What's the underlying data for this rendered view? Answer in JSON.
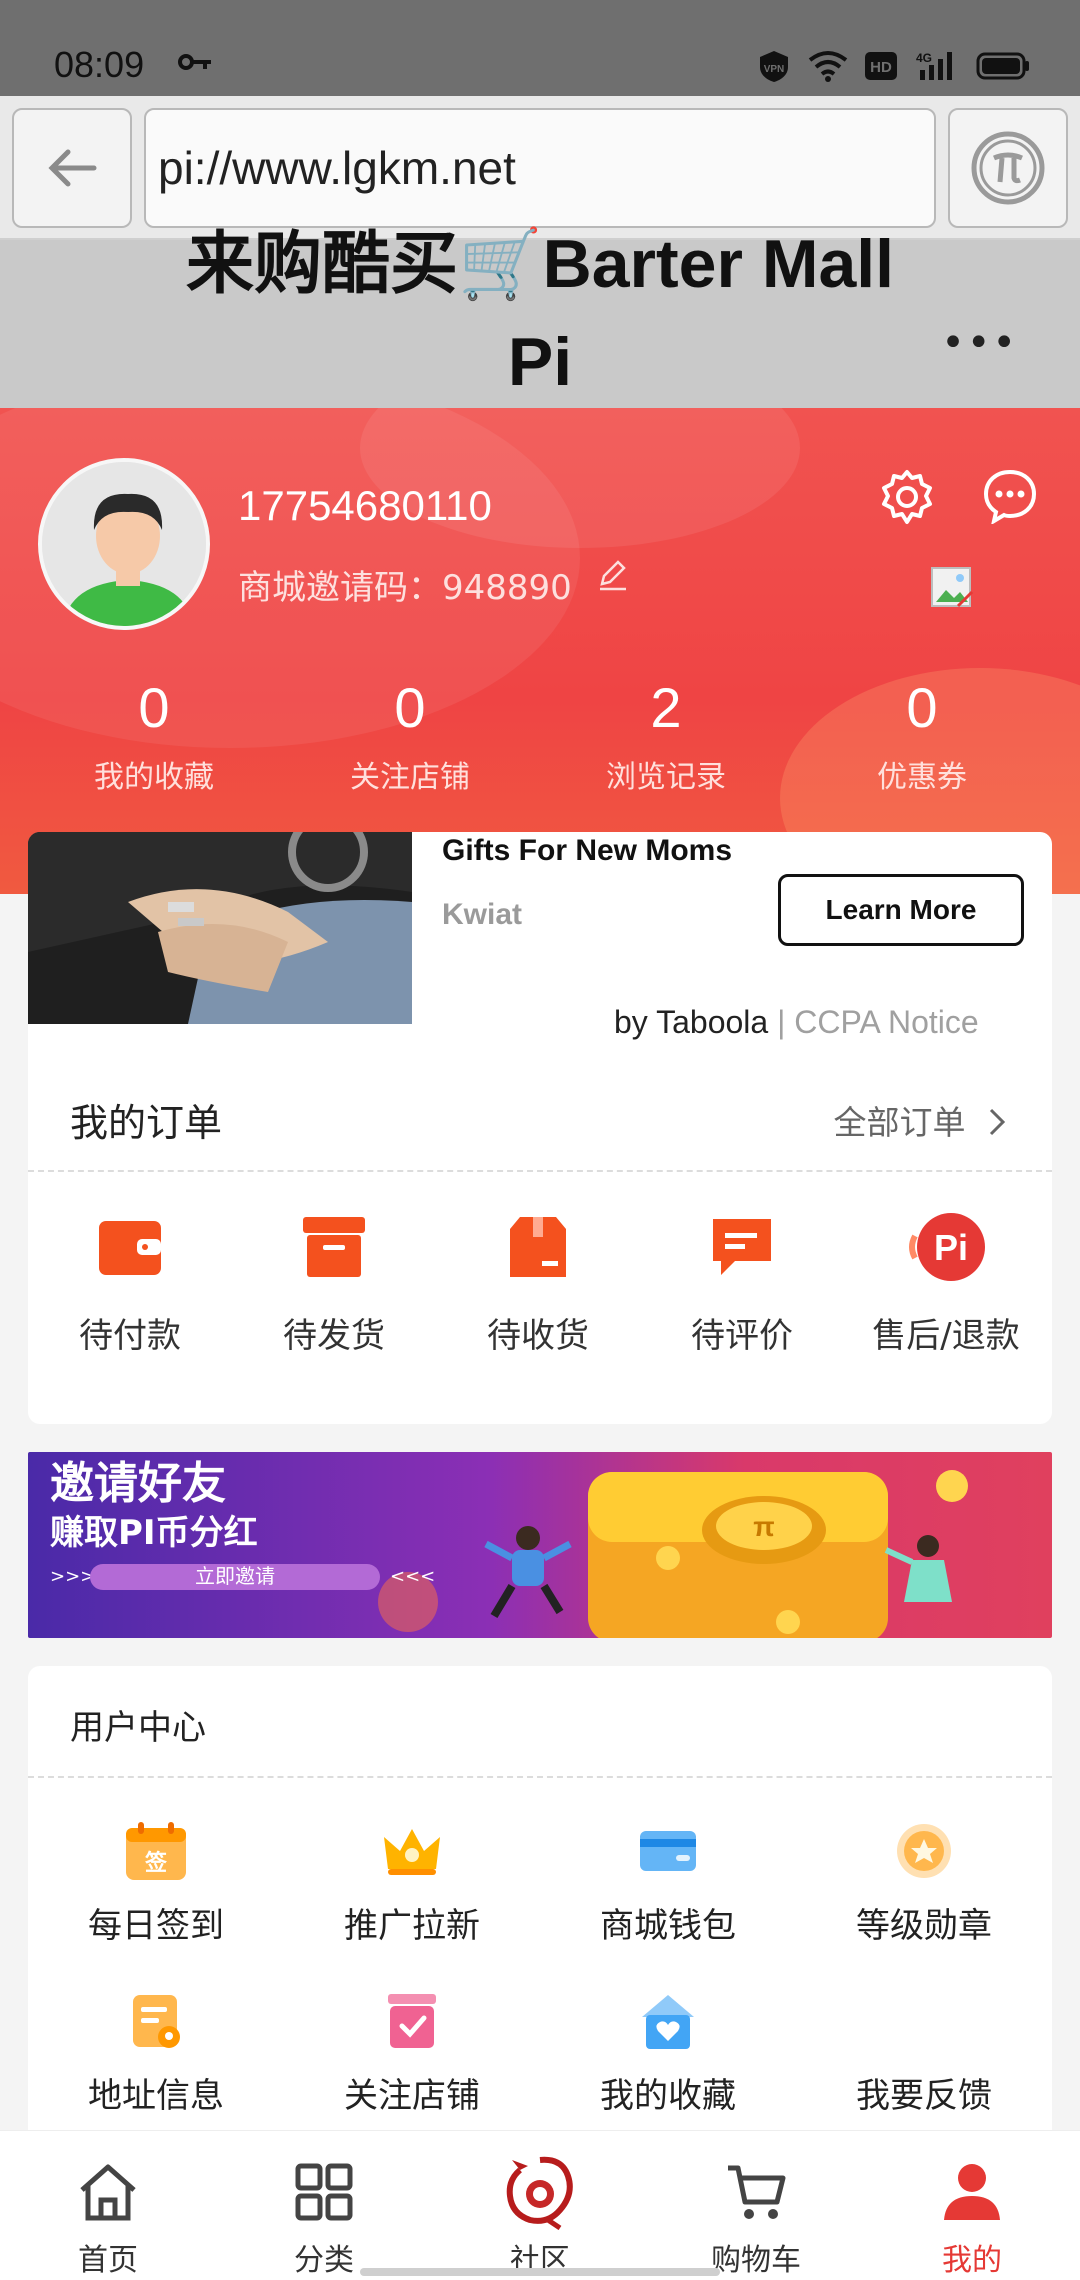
{
  "status_bar": {
    "time": "08:09",
    "icons": [
      "key-icon",
      "vpn-icon",
      "wifi-icon",
      "hd-icon",
      "4g-signal-icon",
      "battery-icon"
    ],
    "vpn_label": "VPN",
    "hd_label": "HD",
    "network_label": "4G"
  },
  "browser": {
    "url": "pi://www.lgkm.net",
    "back_icon": "arrow-left-icon",
    "pi_icon": "pi-icon"
  },
  "site": {
    "title_line1": "来购酷买🛒Barter Mall",
    "title_line2": "Pi",
    "more": "•••"
  },
  "profile": {
    "phone": "17754680110",
    "invite_code": "商城邀请码：948890",
    "stats": [
      {
        "value": "0",
        "label": "我的收藏"
      },
      {
        "value": "0",
        "label": "关注店铺"
      },
      {
        "value": "2",
        "label": "浏览记录"
      },
      {
        "value": "0",
        "label": "优惠券"
      }
    ]
  },
  "ad": {
    "title": "Gifts For New Moms",
    "source": "Kwiat",
    "button": "Learn More",
    "by": "by Taboola",
    "separator": " | ",
    "notice": "CCPA Notice"
  },
  "orders": {
    "title": "我的订单",
    "all_label": "全部订单",
    "items": [
      {
        "label": "待付款",
        "icon": "wallet-icon"
      },
      {
        "label": "待发货",
        "icon": "box-icon"
      },
      {
        "label": "待收货",
        "icon": "package-icon"
      },
      {
        "label": "待评价",
        "icon": "comment-icon"
      },
      {
        "label": "售后/退款",
        "icon": "pi-refund-icon"
      }
    ]
  },
  "banner": {
    "line1": "邀请好友",
    "line2": "赚取PI币分红",
    "cta": "立即邀请",
    "cta_left": ">>>",
    "cta_right": "<<<",
    "coin_symbol": "π"
  },
  "user_center": {
    "title": "用户中心",
    "items": [
      {
        "label": "每日签到",
        "icon": "checkin-calendar-icon"
      },
      {
        "label": "推广拉新",
        "icon": "crown-icon"
      },
      {
        "label": "商城钱包",
        "icon": "wallet-card-icon"
      },
      {
        "label": "等级勋章",
        "icon": "medal-icon"
      },
      {
        "label": "地址信息",
        "icon": "address-icon"
      },
      {
        "label": "关注店铺",
        "icon": "store-follow-icon"
      },
      {
        "label": "我的收藏",
        "icon": "favorite-icon"
      },
      {
        "label": "我要反馈",
        "icon": "feedback-icon"
      }
    ]
  },
  "bottom_nav": {
    "items": [
      {
        "label": "首页",
        "icon": "home-icon"
      },
      {
        "label": "分类",
        "icon": "category-grid-icon"
      },
      {
        "label": "社区",
        "icon": "community-dragon-icon"
      },
      {
        "label": "购物车",
        "icon": "cart-icon"
      },
      {
        "label": "我的",
        "icon": "user-icon"
      }
    ],
    "active_index": 4
  },
  "colors": {
    "accent": "#e53935",
    "profile_bg": "#ef4444",
    "order_icon": "#f4511e"
  }
}
